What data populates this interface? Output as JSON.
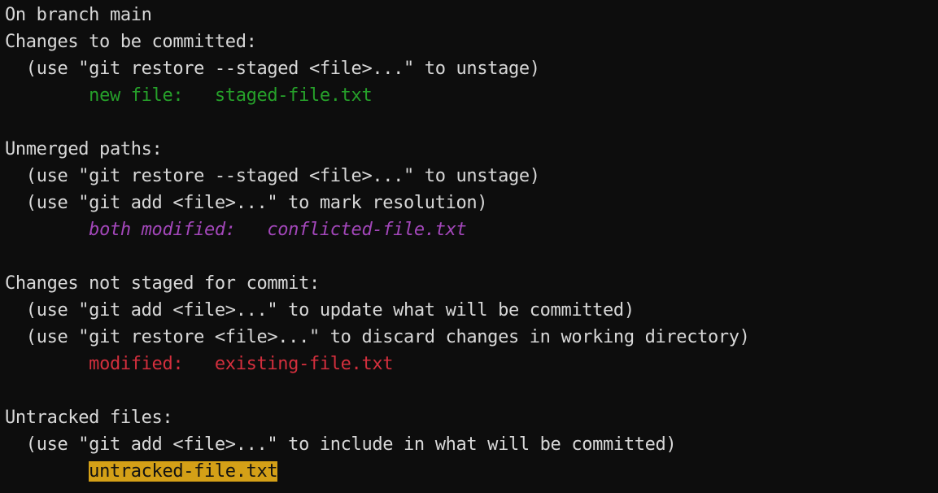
{
  "terminal": {
    "background_color": "#0d0d0d",
    "default_text_color": "#d8d8d8",
    "colors": {
      "green": "#26a02a",
      "red": "#d32f3d",
      "magenta": "#a347ba",
      "highlight_background": "#d4a017",
      "highlight_text": "#121212"
    },
    "lines": [
      {
        "id": "branch",
        "indent": "",
        "text": "On branch main",
        "style": "default"
      },
      {
        "id": "staged-header",
        "indent": "",
        "text": "Changes to be committed:",
        "style": "default"
      },
      {
        "id": "staged-hint-1",
        "indent": "  ",
        "text": "(use \"git restore --staged <file>...\" to unstage)",
        "style": "default"
      },
      {
        "id": "staged-entry-1",
        "indent": "        ",
        "text": "new file:   staged-file.txt",
        "style": "green"
      },
      {
        "id": "spacer-1",
        "indent": "",
        "text": "",
        "style": "blank"
      },
      {
        "id": "unmerged-header",
        "indent": "",
        "text": "Unmerged paths:",
        "style": "default"
      },
      {
        "id": "unmerged-hint-1",
        "indent": "  ",
        "text": "(use \"git restore --staged <file>...\" to unstage)",
        "style": "default"
      },
      {
        "id": "unmerged-hint-2",
        "indent": "  ",
        "text": "(use \"git add <file>...\" to mark resolution)",
        "style": "default"
      },
      {
        "id": "unmerged-entry-1",
        "indent": "        ",
        "text": "both modified:   conflicted-file.txt",
        "style": "magenta"
      },
      {
        "id": "spacer-2",
        "indent": "",
        "text": "",
        "style": "blank"
      },
      {
        "id": "unstaged-header",
        "indent": "",
        "text": "Changes not staged for commit:",
        "style": "default"
      },
      {
        "id": "unstaged-hint-1",
        "indent": "  ",
        "text": "(use \"git add <file>...\" to update what will be committed)",
        "style": "default"
      },
      {
        "id": "unstaged-hint-2",
        "indent": "  ",
        "text": "(use \"git restore <file>...\" to discard changes in working directory)",
        "style": "default"
      },
      {
        "id": "unstaged-entry-1",
        "indent": "        ",
        "text": "modified:   existing-file.txt",
        "style": "red"
      },
      {
        "id": "spacer-3",
        "indent": "",
        "text": "",
        "style": "blank"
      },
      {
        "id": "untracked-header",
        "indent": "",
        "text": "Untracked files:",
        "style": "default"
      },
      {
        "id": "untracked-hint-1",
        "indent": "  ",
        "text": "(use \"git add <file>...\" to include in what will be committed)",
        "style": "default"
      },
      {
        "id": "untracked-entry-1",
        "indent": "        ",
        "text": "untracked-file.txt",
        "style": "highlight"
      }
    ]
  }
}
